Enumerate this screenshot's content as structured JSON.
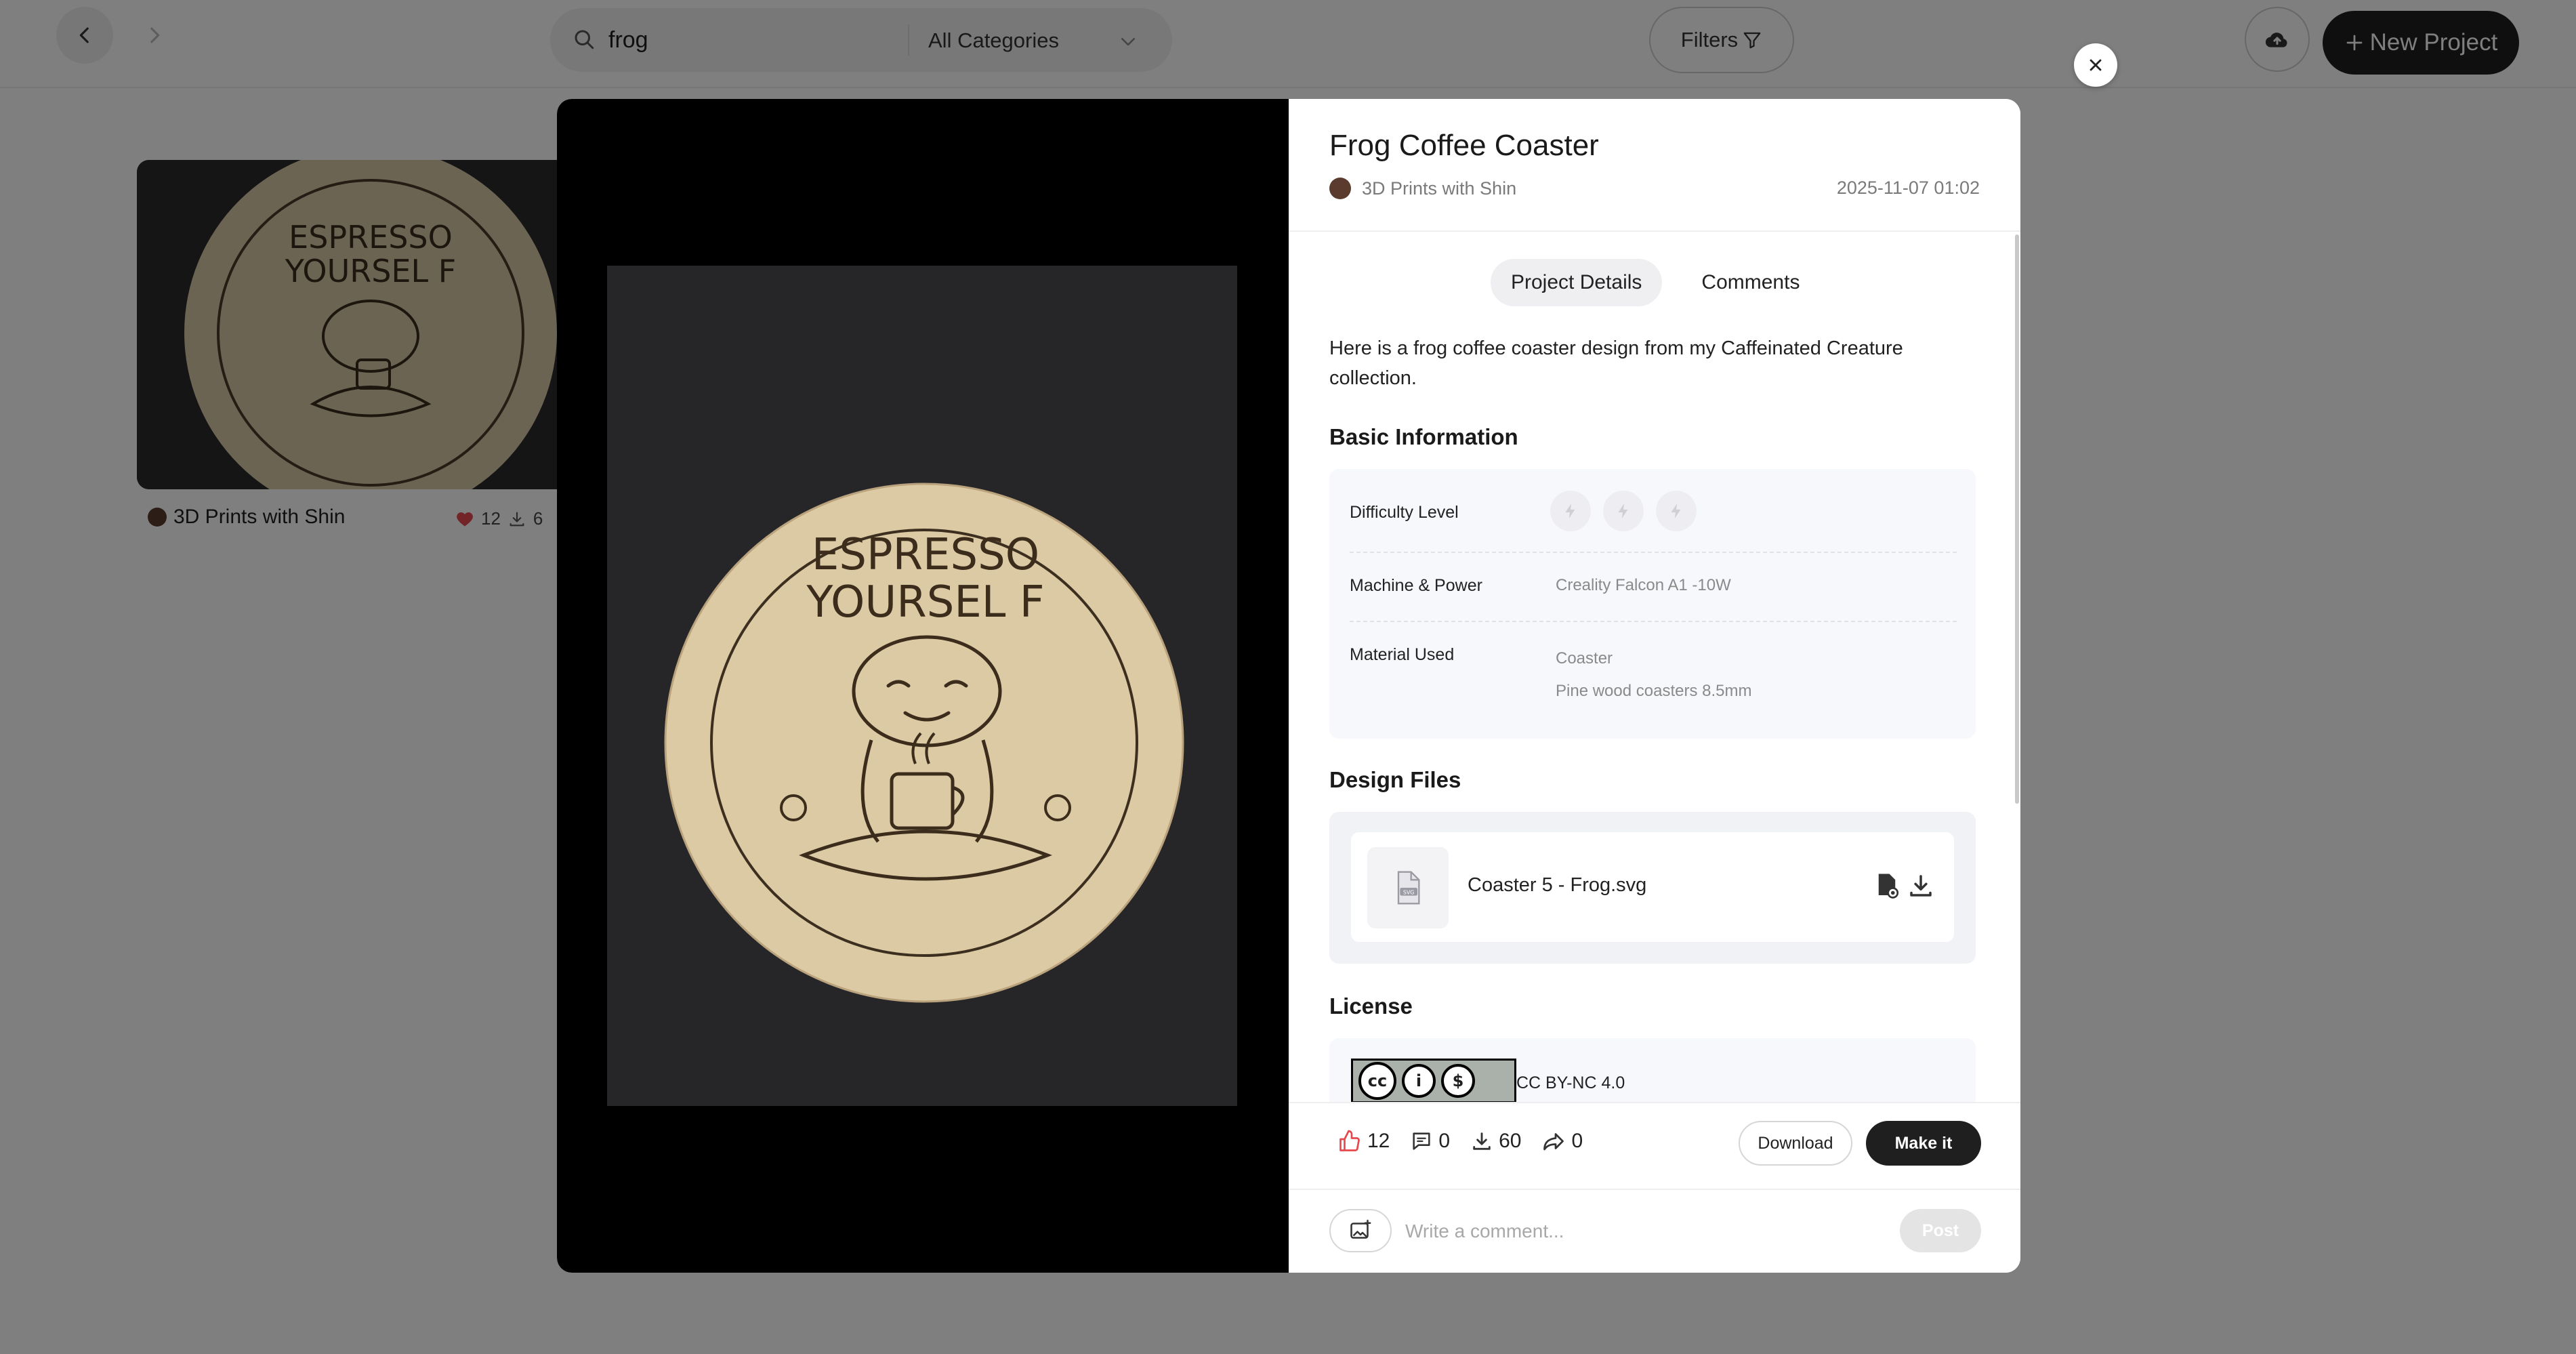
{
  "topbar": {
    "search_value": "frog",
    "category": "All Categories",
    "filters_label": "Filters",
    "new_project_label": "New Project"
  },
  "background_card": {
    "coaster_line1": "ESPRESSO",
    "coaster_line2": "YOURSEL F",
    "author": "3D Prints with Shin",
    "likes": "12",
    "downloads": "6"
  },
  "project": {
    "title": "Frog Coffee Coaster",
    "author": "3D Prints with Shin",
    "date": "2025-11-07 01:02",
    "photo_line1": "ESPRESSO",
    "photo_line2": "YOURSEL F"
  },
  "tabs": [
    {
      "label": "Project Details",
      "active": true
    },
    {
      "label": "Comments",
      "active": false
    }
  ],
  "description": "Here is a frog coffee coaster design from my Caffeinated Creature collection.",
  "basic_info": {
    "title": "Basic Information",
    "difficulty_label": "Difficulty Level",
    "machine_label": "Machine & Power",
    "machine_value": "Creality Falcon A1 -10W",
    "material_label": "Material Used",
    "material_values": [
      "Coaster",
      "Pine wood coasters 8.5mm"
    ]
  },
  "design_files": {
    "title": "Design Files",
    "file_type": "SVG",
    "file_name": "Coaster 5 - Frog.svg"
  },
  "license": {
    "title": "License",
    "text": "CC BY-NC 4.0"
  },
  "footer": {
    "likes": "12",
    "comments": "0",
    "downloads": "60",
    "shares": "0",
    "download_label": "Download",
    "make_label": "Make it",
    "comment_placeholder": "Write a comment...",
    "post_label": "Post"
  },
  "colors": {
    "accent_dark": "#1f1f1f",
    "like_red": "#e5484d",
    "overlay": "rgba(0,0,0,0.5)"
  }
}
